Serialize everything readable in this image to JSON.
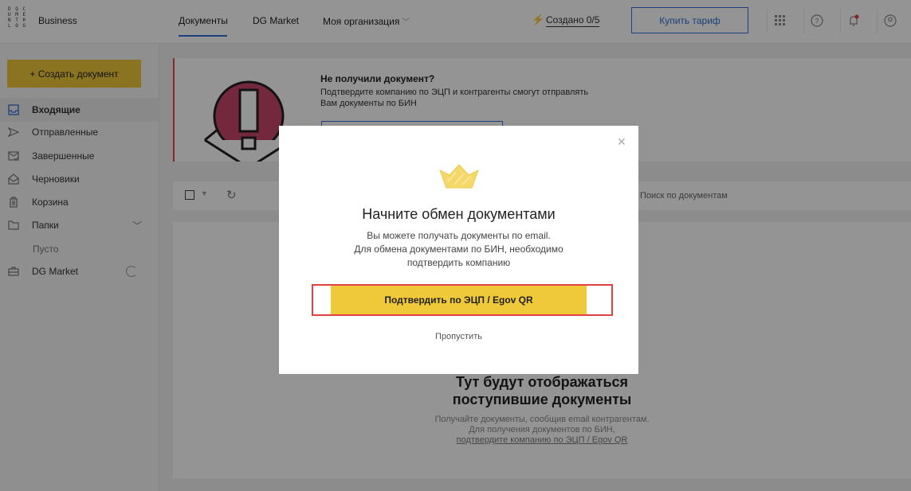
{
  "app": {
    "logo_text": "D Q C U M E N T D L O G",
    "brand": "Business"
  },
  "header": {
    "tabs": [
      {
        "label": "Документы"
      },
      {
        "label": "DG Market"
      },
      {
        "label": "Моя организация"
      }
    ],
    "created_label": "Создано 0/5",
    "buy_label": "Купить тариф",
    "icons": [
      "apps-grid-icon",
      "help-icon",
      "notification-bell-icon",
      "user-avatar-icon"
    ],
    "accent_color": "#2f6fd6"
  },
  "sidebar": {
    "create_label": "+ Создать документ",
    "items": [
      {
        "label": "Входящие",
        "icon": "inbox-icon"
      },
      {
        "label": "Отправленные",
        "icon": "send-icon"
      },
      {
        "label": "Завершенные",
        "icon": "completed-icon"
      },
      {
        "label": "Черновики",
        "icon": "drafts-icon"
      },
      {
        "label": "Корзина",
        "icon": "trash-icon"
      },
      {
        "label": "Папки",
        "icon": "folder-icon"
      },
      {
        "label": "DG Market",
        "icon": "briefcase-icon"
      }
    ],
    "folders_empty": "Пусто"
  },
  "banner": {
    "title": "Не получили документ?",
    "text": "Подтвердите компанию по ЭЦП и контрагенты смогут отправлять Вам документы по БИН"
  },
  "toolbar": {
    "search_placeholder": "Поиск по документам"
  },
  "empty_state": {
    "title_line1": "Тут будут отображаться",
    "title_line2": "поступившие документы",
    "text_line1": "Получайте документы, сообщив email контрагентам.",
    "text_line2": "Для получения документов по БИН,",
    "link": "подтвердите компанию по ЭЦП / Egov QR"
  },
  "modal": {
    "title": "Начните обмен документами",
    "line1": "Вы можете получать документы по email.",
    "line2": "Для обмена документами по БИН, необходимо",
    "line3": "подтвердить компанию",
    "confirm_label": "Подтвердить по ЭЦП / Egov QR",
    "skip_label": "Пропустить",
    "button_color": "#f0c93a",
    "highlight_color": "#e04040"
  }
}
